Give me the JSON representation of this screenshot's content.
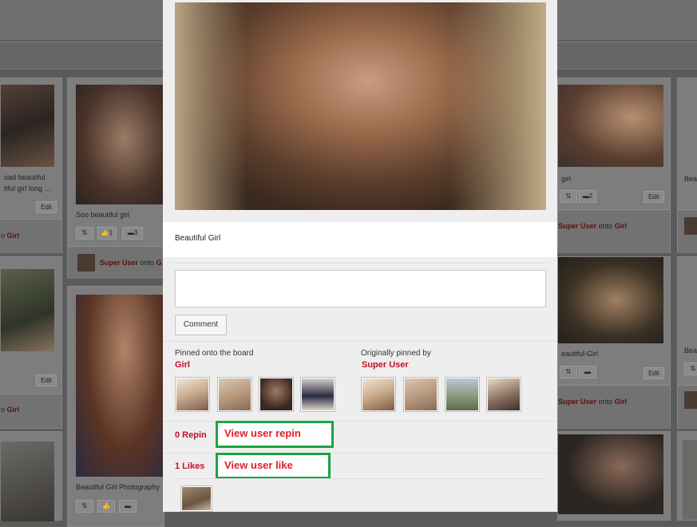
{
  "background": {
    "pins": [
      {
        "caption_lines": [
          "oad beautiful",
          "tiful girl long ..."
        ],
        "edit_label": "Edit",
        "meta_user": "",
        "meta_onto": "o",
        "meta_board": "Girl"
      },
      {
        "caption_lines": [
          "Soo beautiful girl"
        ],
        "like_count": "1",
        "comment_count": "3",
        "meta_user": "Super User",
        "meta_onto": "onto",
        "meta_board": "G"
      },
      {
        "caption_lines": [],
        "edit_label": "Edit",
        "meta_user": "",
        "meta_onto": "o",
        "meta_board": "Girl"
      },
      {
        "caption_lines": [
          "Beautiful Girl Photography"
        ]
      },
      {
        "caption_lines": [
          "girl"
        ],
        "like_count": "2",
        "edit_label": "Edit",
        "meta_user": "Super User",
        "meta_onto": "onto",
        "meta_board": "Girl"
      },
      {
        "caption_lines": [
          "eautiful-Girl"
        ],
        "edit_label": "Edit",
        "meta_user": "Super User",
        "meta_onto": "onto",
        "meta_board": "Girl"
      },
      {
        "caption_lines": [
          "Bea"
        ]
      },
      {
        "caption_lines": [
          "Bea"
        ]
      }
    ]
  },
  "modal": {
    "caption": "Beautiful Girl",
    "comment_button": "Comment",
    "board_section": {
      "label": "Pinned onto the board",
      "board_name": "Girl"
    },
    "origin_section": {
      "label": "Originally pinned by",
      "user_name": "Super User"
    },
    "repin": {
      "count_label": "0 Repin",
      "callout": "View user repin"
    },
    "likes": {
      "count_label": "1 Likes",
      "callout": "View user like"
    },
    "board_thumbs": [
      "#c9a98b",
      "#b89a7e",
      "#7a5a48",
      "#2a2c45"
    ],
    "origin_thumbs": [
      "#c9a98b",
      "#b89a7e",
      "#8a9a7a",
      "#8a7060"
    ]
  },
  "colors": {
    "accent": "#c0112a",
    "callout_border": "#1aa545",
    "callout_text": "#e0202a"
  }
}
